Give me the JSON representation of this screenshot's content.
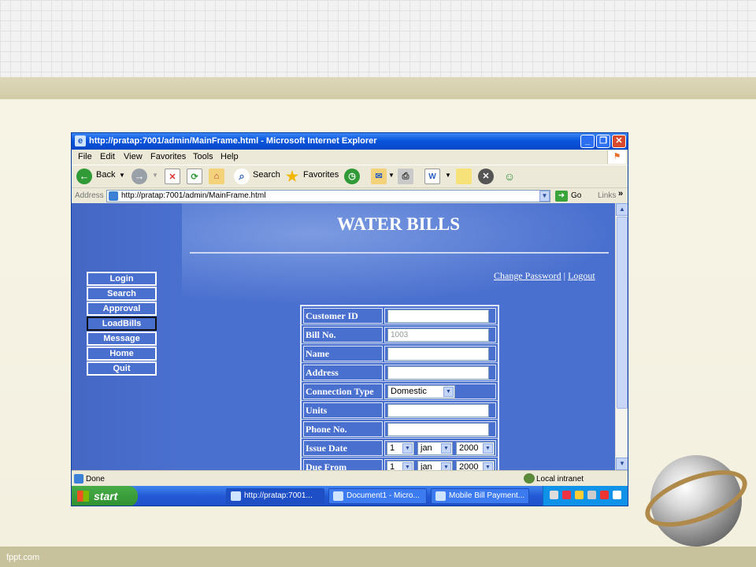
{
  "slide": {
    "footer": "fppt.com"
  },
  "window": {
    "title": "http://pratap:7001/admin/MainFrame.html - Microsoft Internet Explorer",
    "controls": {
      "minimize": "_",
      "maximize": "❐",
      "close": "✕"
    }
  },
  "menubar": {
    "items": [
      "File",
      "Edit",
      "View",
      "Favorites",
      "Tools",
      "Help"
    ]
  },
  "toolbar": {
    "back": "Back",
    "search": "Search",
    "favorites": "Favorites"
  },
  "addressbar": {
    "label": "Address",
    "url": "http://pratap:7001/admin/MainFrame.html",
    "go": "Go",
    "links": "Links"
  },
  "page": {
    "heading": "WATER BILLS",
    "links": {
      "change_password": "Change Password",
      "separator": "|",
      "logout": "Logout"
    },
    "nav": [
      {
        "label": "Login"
      },
      {
        "label": "Search"
      },
      {
        "label": "Approval"
      },
      {
        "label": "LoadBills",
        "active": true
      },
      {
        "label": "Message"
      },
      {
        "label": "Home"
      },
      {
        "label": "Quit"
      }
    ],
    "form": {
      "customer_id": {
        "label": "Customer ID",
        "value": ""
      },
      "bill_no": {
        "label": "Bill No.",
        "value": "1003"
      },
      "name": {
        "label": "Name",
        "value": ""
      },
      "address": {
        "label": "Address",
        "value": ""
      },
      "connection_type": {
        "label": "Connection Type",
        "value": "Domestic"
      },
      "units": {
        "label": "Units",
        "value": ""
      },
      "phone_no": {
        "label": "Phone No.",
        "value": ""
      },
      "issue_date": {
        "label": "Issue Date",
        "day": "1",
        "month": "jan",
        "year": "2000"
      },
      "due_from": {
        "label": "Due From",
        "day": "1",
        "month": "jan",
        "year": "2000"
      }
    }
  },
  "statusbar": {
    "status": "Done",
    "zone": "Local intranet"
  },
  "taskbar": {
    "start": "start",
    "tasks": [
      "http://pratap:7001...",
      "Document1 - Micro...",
      "Mobile Bill Payment..."
    ]
  },
  "colors": {
    "page_bg": "#4a70cf",
    "titlebar": "#0a55dd",
    "taskbar": "#2459d6",
    "start": "#2f8f2f"
  }
}
